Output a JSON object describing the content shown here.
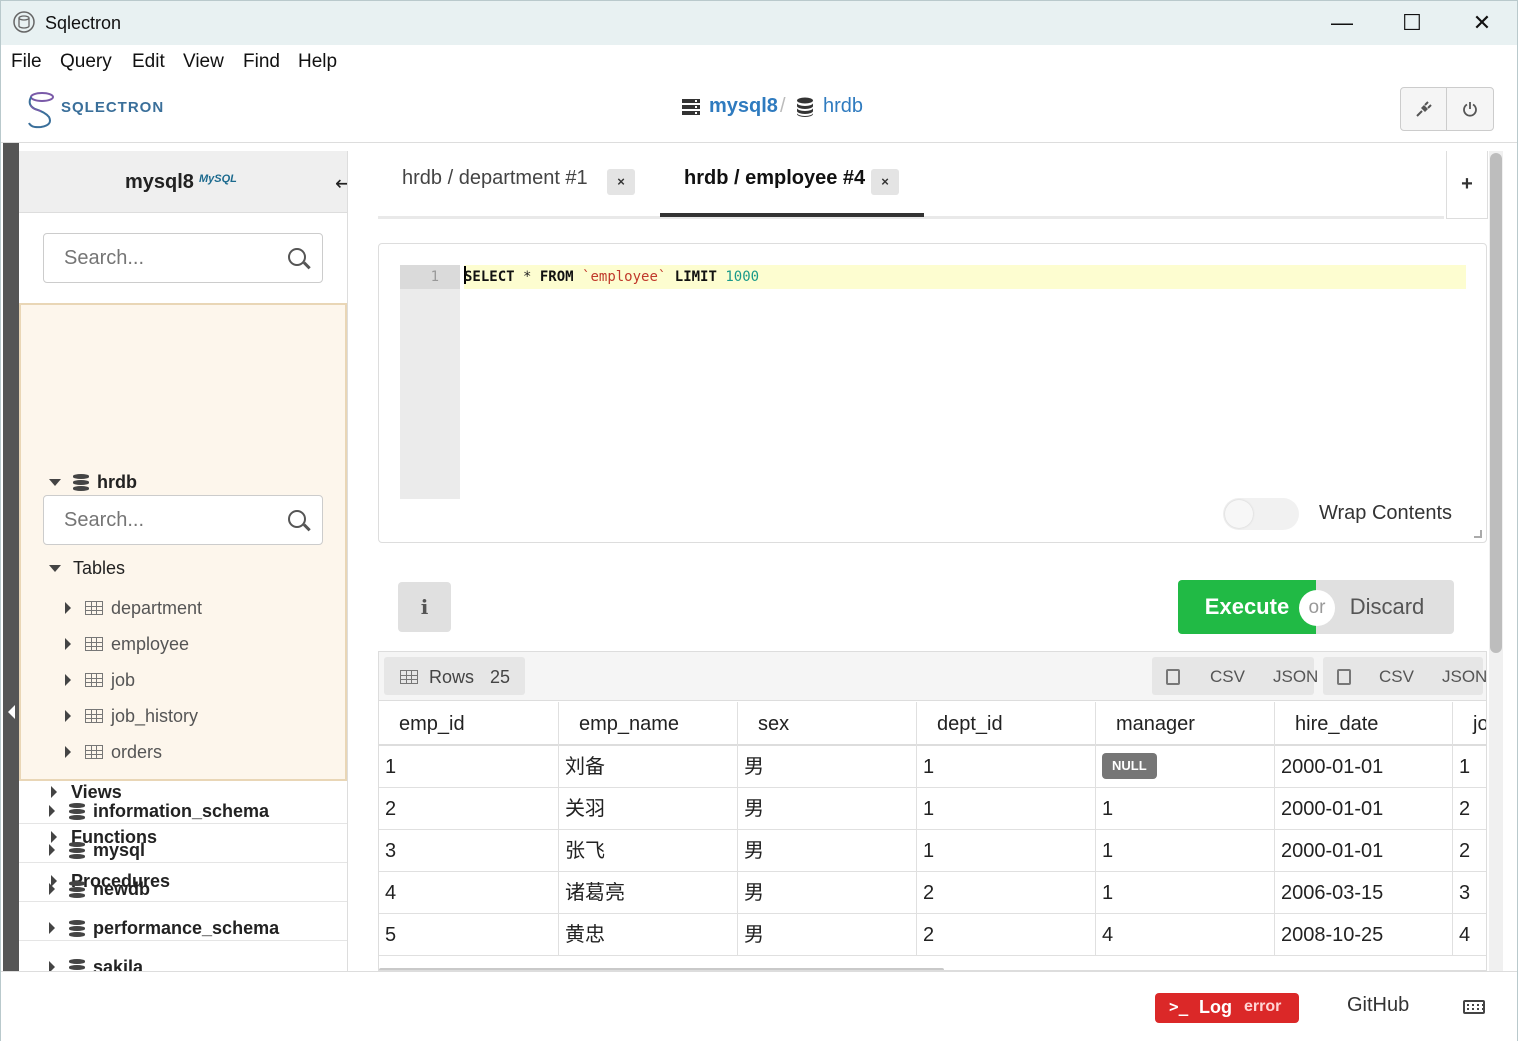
{
  "window": {
    "title": "Sqlectron",
    "minimize": "—",
    "maximize": "☐",
    "close": "✕"
  },
  "menu": [
    "File",
    "Query",
    "Edit",
    "View",
    "Find",
    "Help"
  ],
  "header": {
    "logo_text": "SQLECTRON",
    "server": "mysql8",
    "separator": "/",
    "database": "hrdb",
    "disconnect_icon": "plug-icon",
    "power_icon": "power-icon"
  },
  "sidebar": {
    "server_title": "mysql8",
    "server_logo": "MySQL",
    "search_placeholder": "Search...",
    "db": {
      "name": "hrdb",
      "search_placeholder": "Search...",
      "tables_label": "Tables",
      "tables": [
        "department",
        "employee",
        "job",
        "job_history",
        "orders"
      ],
      "views_label": "Views",
      "functions_label": "Functions",
      "procedures_label": "Procedures"
    },
    "other_dbs": [
      "information_schema",
      "mysql",
      "newdb",
      "performance_schema",
      "sakila"
    ]
  },
  "tabs": [
    {
      "label": "hrdb / department #1",
      "close": "×",
      "active": false
    },
    {
      "label": "hrdb / employee #4",
      "close": "×",
      "active": true
    }
  ],
  "add_tab": "+",
  "editor": {
    "line_number": "1",
    "tokens": {
      "kw1": "SELECT",
      "op": " * ",
      "kw2": "FROM",
      "tbl": "`employee`",
      "kw3": "LIMIT",
      "num": "1000"
    },
    "wrap_label": "Wrap Contents",
    "wrap_enabled": false
  },
  "actions": {
    "info": "i",
    "execute": "Execute",
    "or": "or",
    "discard": "Discard"
  },
  "results": {
    "rows_label": "Rows",
    "rows_count": "25",
    "copy_csv": "CSV",
    "copy_json": "JSON",
    "save_csv": "CSV",
    "save_json": "JSON",
    "columns": [
      "emp_id",
      "emp_name",
      "sex",
      "dept_id",
      "manager",
      "hire_date",
      "job_id"
    ],
    "rows": [
      [
        "1",
        "刘备",
        "男",
        "1",
        "NULL",
        "2000-01-01",
        "1"
      ],
      [
        "2",
        "关羽",
        "男",
        "1",
        "1",
        "2000-01-01",
        "2"
      ],
      [
        "3",
        "张飞",
        "男",
        "1",
        "1",
        "2000-01-01",
        "2"
      ],
      [
        "4",
        "诸葛亮",
        "男",
        "2",
        "1",
        "2006-03-15",
        "3"
      ],
      [
        "5",
        "黄忠",
        "男",
        "2",
        "4",
        "2008-10-25",
        "4"
      ]
    ]
  },
  "footer": {
    "log_prompt": ">_",
    "log_label": "Log",
    "log_status": "error",
    "github": "GitHub"
  }
}
